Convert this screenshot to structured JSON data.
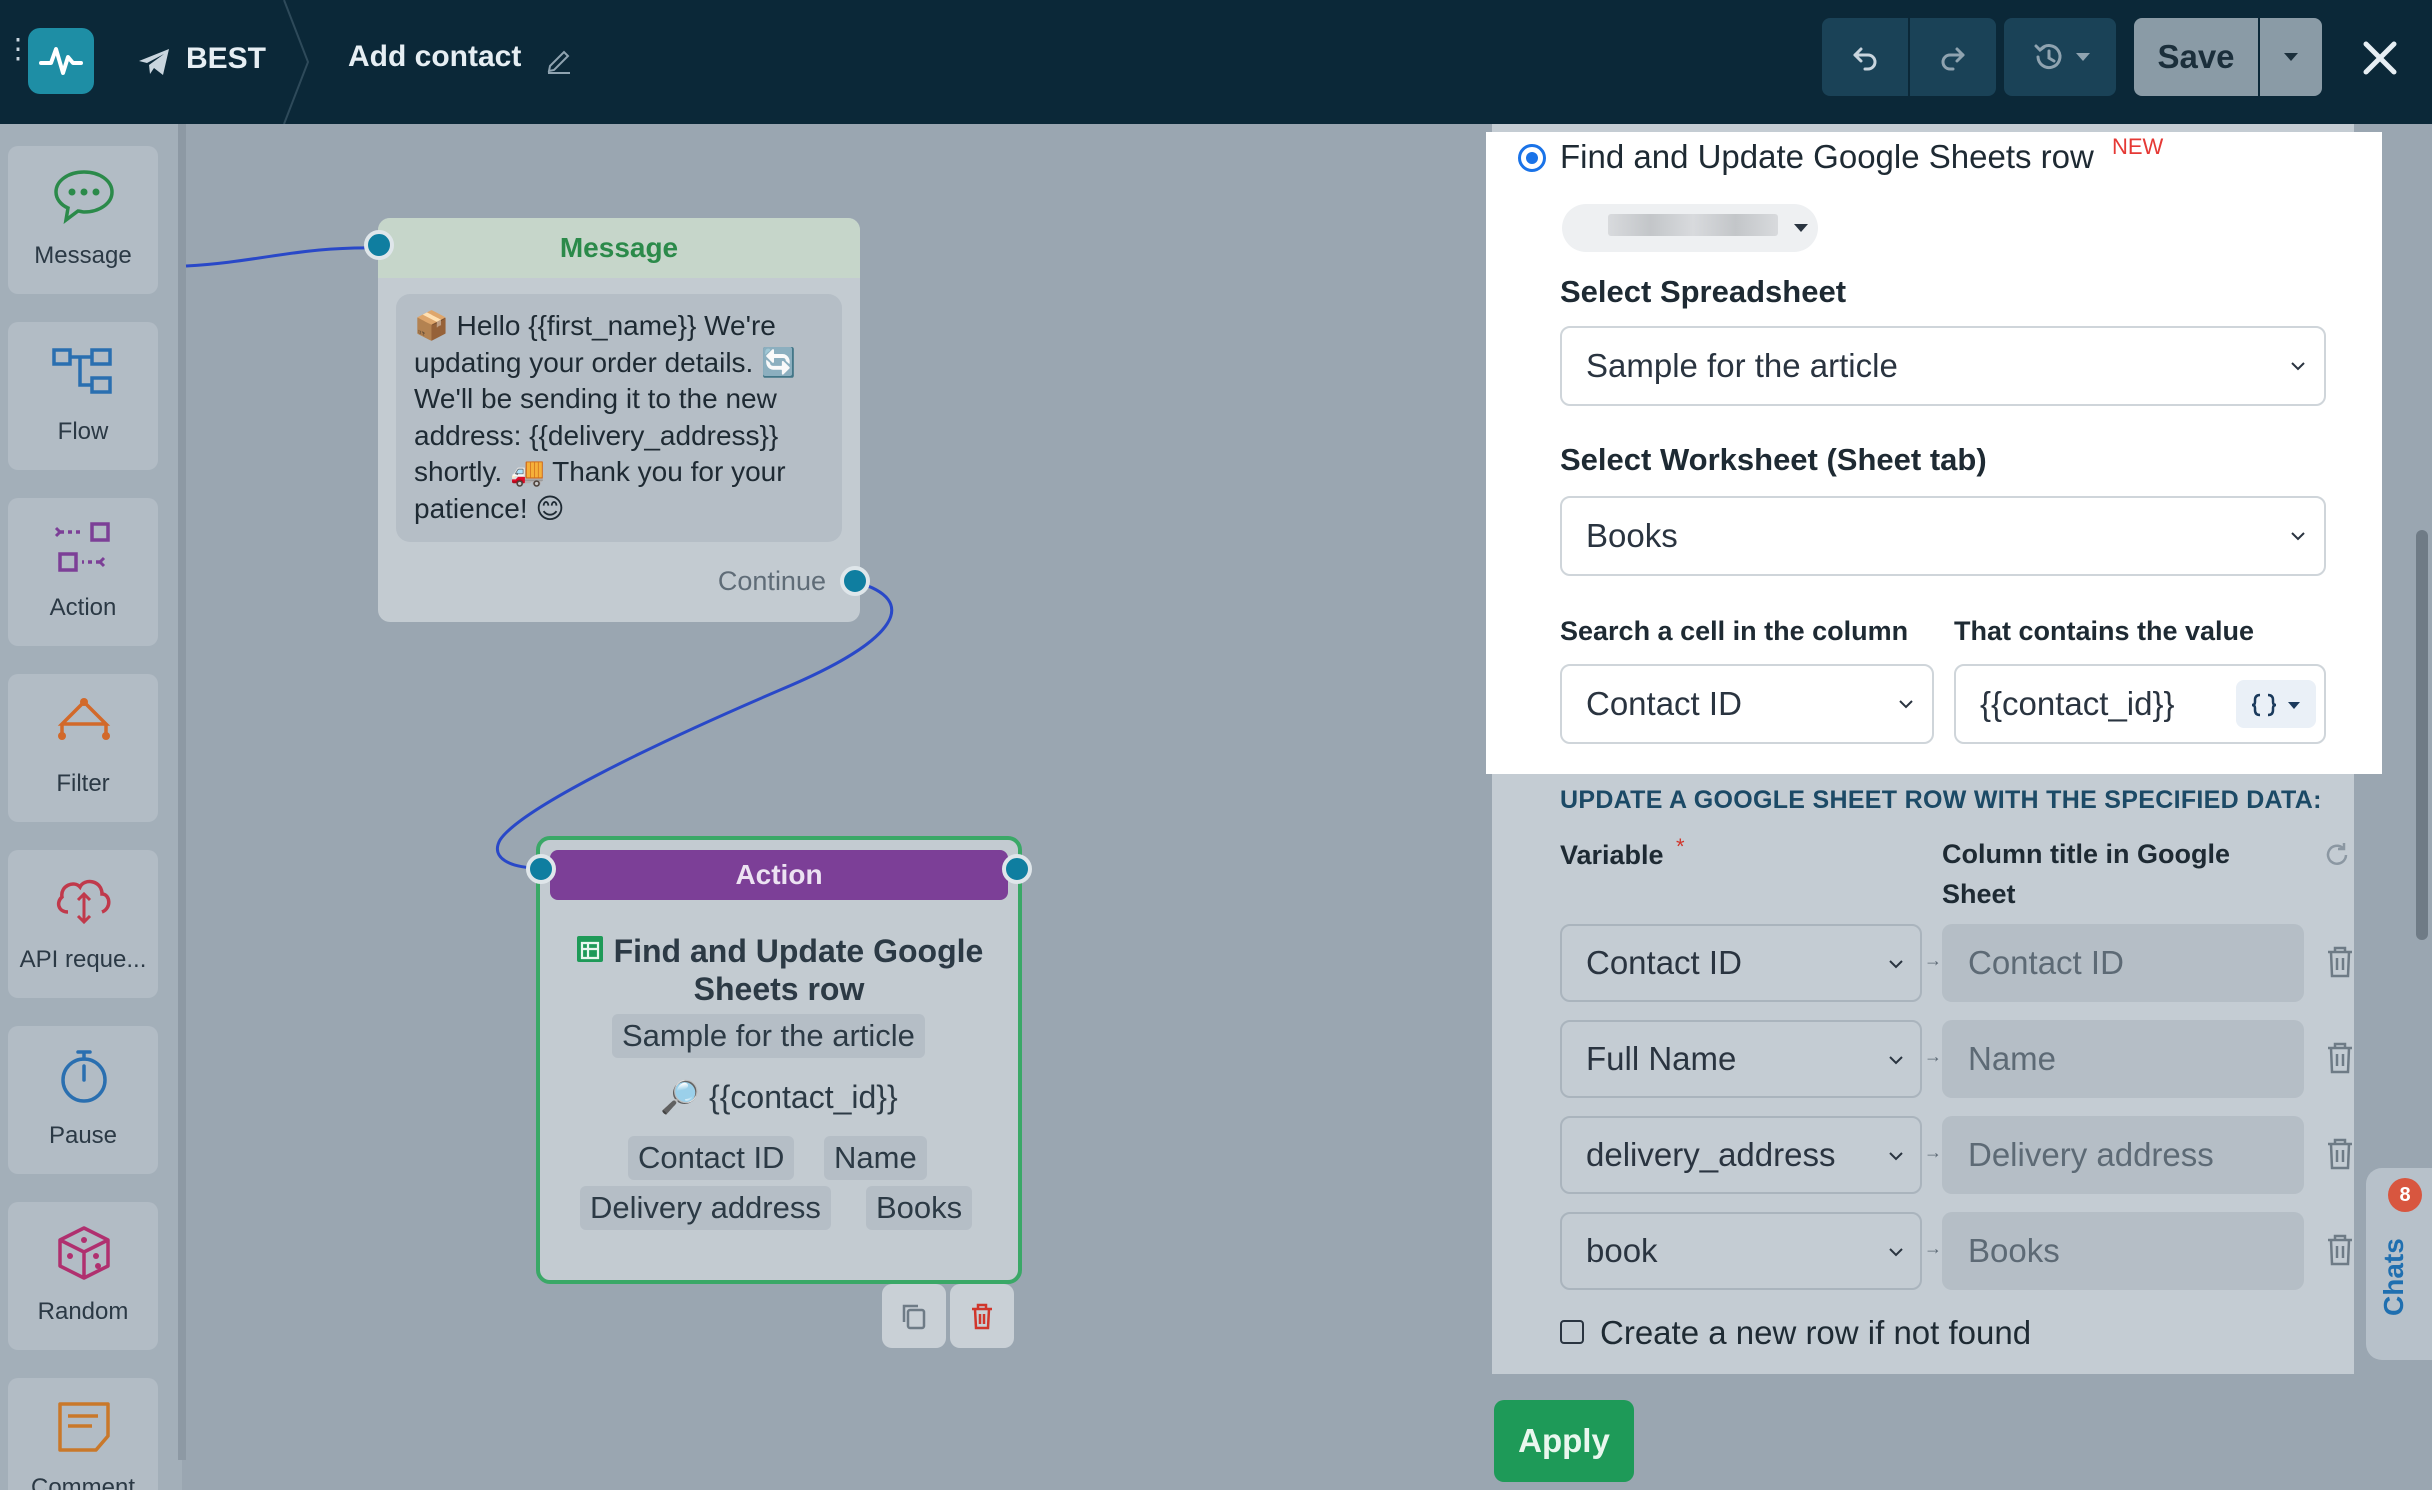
{
  "topbar": {
    "bot_name": "BEST",
    "flow_name": "Add contact",
    "save_label": "Save"
  },
  "sidebar": {
    "items": [
      {
        "label": "Message",
        "icon": "message-icon"
      },
      {
        "label": "Flow",
        "icon": "flow-icon"
      },
      {
        "label": "Action",
        "icon": "action-icon"
      },
      {
        "label": "Filter",
        "icon": "filter-icon"
      },
      {
        "label": "API reque...",
        "icon": "api-request-icon"
      },
      {
        "label": "Pause",
        "icon": "pause-icon"
      },
      {
        "label": "Random",
        "icon": "random-icon"
      },
      {
        "label": "Comment",
        "icon": "comment-icon"
      }
    ]
  },
  "canvas": {
    "message_node": {
      "title": "Message",
      "text": "📦 Hello {{first_name}} We're updating your order details. 🔄 We'll be sending it to the new address: {{delivery_address}} shortly. 🚚 Thank you for your patience! 😊",
      "continue_label": "Continue"
    },
    "action_node": {
      "title": "Action",
      "action_title": "Find and Update Google Sheets row",
      "spreadsheet": "Sample for the article",
      "search_value": "🔎 {{contact_id}}",
      "chips": [
        "Contact ID",
        "Name",
        "Delivery address",
        "Books"
      ]
    }
  },
  "panel": {
    "option_title": "Find and Update Google Sheets row",
    "new_tag": "NEW",
    "spreadsheet_label": "Select Spreadsheet",
    "spreadsheet_value": "Sample for the article",
    "worksheet_label": "Select Worksheet (Sheet tab)",
    "worksheet_value": "Books",
    "search_column_label": "Search a cell in the column",
    "search_column_value": "Contact ID",
    "contains_label": "That contains the value",
    "contains_value": "{{contact_id}}",
    "section_title": "UPDATE A GOOGLE SHEET ROW WITH THE SPECIFIED DATA:",
    "variable_header": "Variable",
    "required_mark": "*",
    "column_header": "Column title in Google Sheet",
    "mappings": [
      {
        "variable": "Contact ID",
        "column": "Contact ID"
      },
      {
        "variable": "Full Name",
        "column": "Name"
      },
      {
        "variable": "delivery_address",
        "column": "Delivery address"
      },
      {
        "variable": "book",
        "column": "Books"
      }
    ],
    "create_row_label": "Create a new row if not found",
    "apply_label": "Apply"
  },
  "chats": {
    "label": "Chats",
    "badge": "8"
  },
  "colors": {
    "topbar": "#0b2838",
    "brand": "#1e8ea5",
    "message_header": "#2b8a4a",
    "action_header": "#7c3f97",
    "apply": "#1e9a58",
    "new_tag": "#e53935"
  }
}
